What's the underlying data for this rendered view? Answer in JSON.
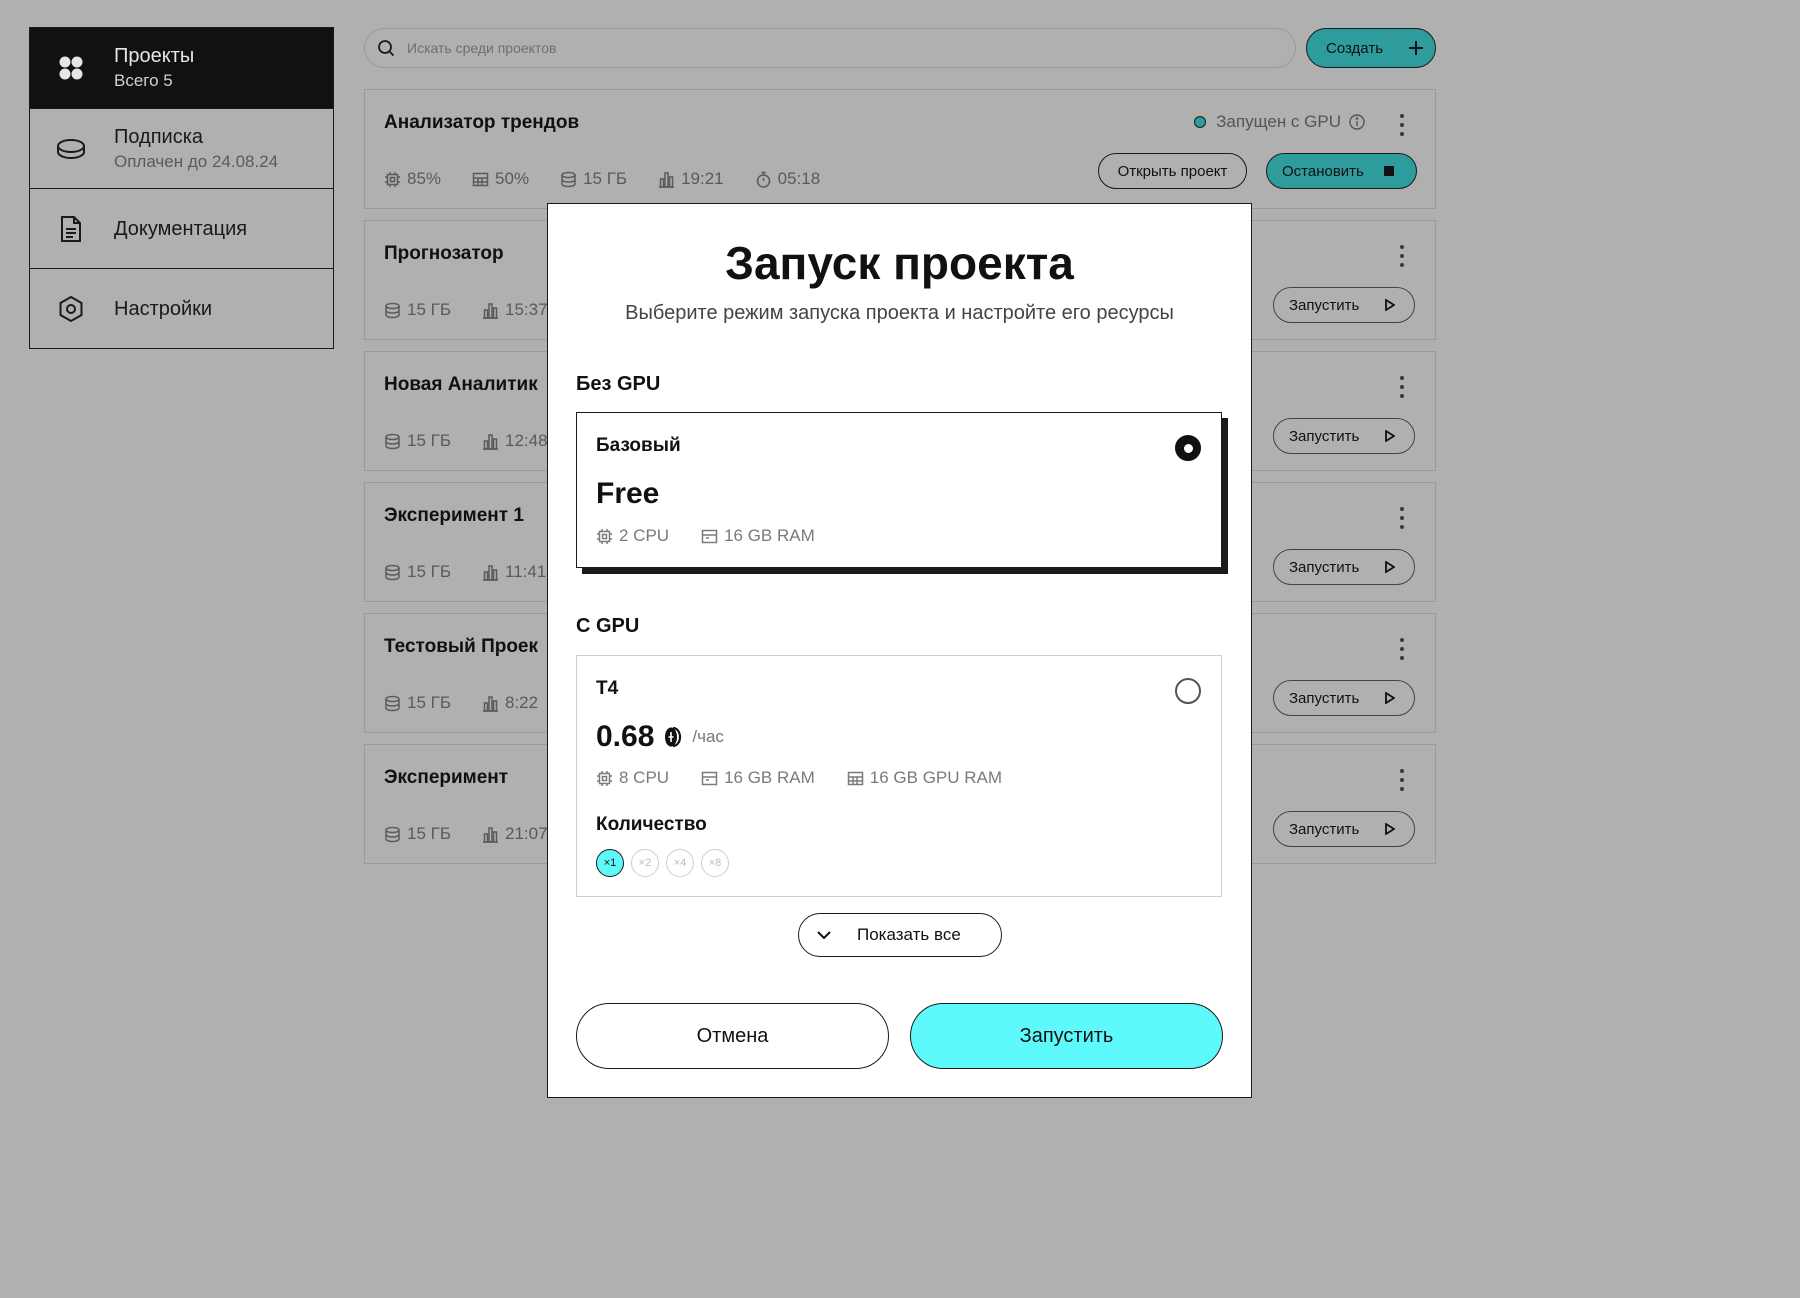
{
  "sidebar": {
    "items": [
      {
        "title": "Проекты",
        "subtitle": "Всего 5",
        "icon": "grid-icon"
      },
      {
        "title": "Подписка",
        "subtitle": "Оплачен до 24.08.24",
        "icon": "coin-icon"
      },
      {
        "title": "Документация",
        "icon": "document-icon"
      },
      {
        "title": "Настройки",
        "icon": "settings-icon"
      }
    ]
  },
  "search": {
    "placeholder": "Искать среди проектов"
  },
  "create_label": "Создать",
  "projects": [
    {
      "title": "Анализатор трендов",
      "status": "Запущен с GPU",
      "stats": {
        "cpu": "85%",
        "ram": "50%",
        "disk": "15 ГБ",
        "time": "19:21",
        "timer": "05:18"
      },
      "open_label": "Открыть проект",
      "stop_label": "Остановить"
    },
    {
      "title": "Прогнозатор",
      "disk": "15 ГБ",
      "time": "15:37",
      "run_label": "Запустить"
    },
    {
      "title": "Новая Аналитик",
      "disk": "15 ГБ",
      "time": "12:48",
      "run_label": "Запустить"
    },
    {
      "title": "Эксперимент 1",
      "disk": "15 ГБ",
      "time": "11:41",
      "run_label": "Запустить"
    },
    {
      "title": "Тестовый Проек",
      "disk": "15 ГБ",
      "time": "8:22",
      "run_label": "Запустить"
    },
    {
      "title": "Эксперимент",
      "disk": "15 ГБ",
      "time": "21:07",
      "run_label": "Запустить"
    }
  ],
  "modal": {
    "title": "Запуск проекта",
    "subtitle": "Выберите режим запуска проекта и настройте его ресурсы",
    "no_gpu_section": "Без GPU",
    "gpu_section": "С GPU",
    "basic": {
      "name": "Базовый",
      "price": "Free",
      "cpu": "2 CPU",
      "ram": "16 GB RAM",
      "selected": true
    },
    "t4": {
      "name": "T4",
      "price": "0.68",
      "per": "/час",
      "cpu": "8 CPU",
      "ram": "16 GB RAM",
      "gpu_ram": "16 GB GPU RAM",
      "selected": false
    },
    "quantity_label": "Количество",
    "quantity_options": [
      "×1",
      "×2",
      "×4",
      "×8"
    ],
    "quantity_selected": "×1",
    "show_all": "Показать все",
    "cancel": "Отмена",
    "launch": "Запустить"
  },
  "colors": {
    "accent": "#5ef9fb",
    "accent_dim": "#2e9c9c",
    "backdrop": "#b0b0b0"
  }
}
